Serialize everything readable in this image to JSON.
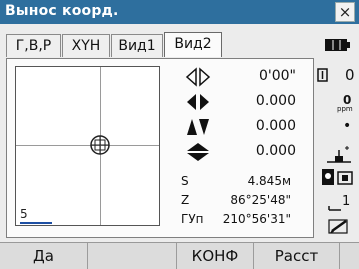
{
  "window": {
    "title": "Вынос коорд.",
    "close_label": "×"
  },
  "tabs": [
    {
      "label": "Г,В,Р",
      "active": false
    },
    {
      "label": "XYH",
      "active": false
    },
    {
      "label": "Вид1",
      "active": false
    },
    {
      "label": "Вид2",
      "active": true
    }
  ],
  "plot": {
    "scale": "5"
  },
  "indicators": [
    {
      "icon": "hollow-diamond-arrows-icon",
      "value": "0'00\""
    },
    {
      "icon": "left-right-triangles-icon",
      "value": "0.000"
    },
    {
      "icon": "up-down-triangles-icon",
      "value": "0.000"
    },
    {
      "icon": "stacked-triangles-icon",
      "value": "0.000"
    }
  ],
  "measurements": [
    {
      "label": "S",
      "value": "4.845м"
    },
    {
      "label": "Z",
      "value": "86°25'48\""
    },
    {
      "label": "ГУп",
      "value": "210°56'31\""
    }
  ],
  "status": {
    "ppm_value": "0",
    "ppm_unit": "ppm",
    "top_value": "0",
    "small_mark": "1"
  },
  "softkeys": [
    {
      "label": "Да"
    },
    {
      "label": ""
    },
    {
      "label": "КОНФ"
    },
    {
      "label": "Расст"
    }
  ],
  "colors": {
    "title_bar": "#2e6f9e",
    "accent": "#1d4fa3"
  }
}
